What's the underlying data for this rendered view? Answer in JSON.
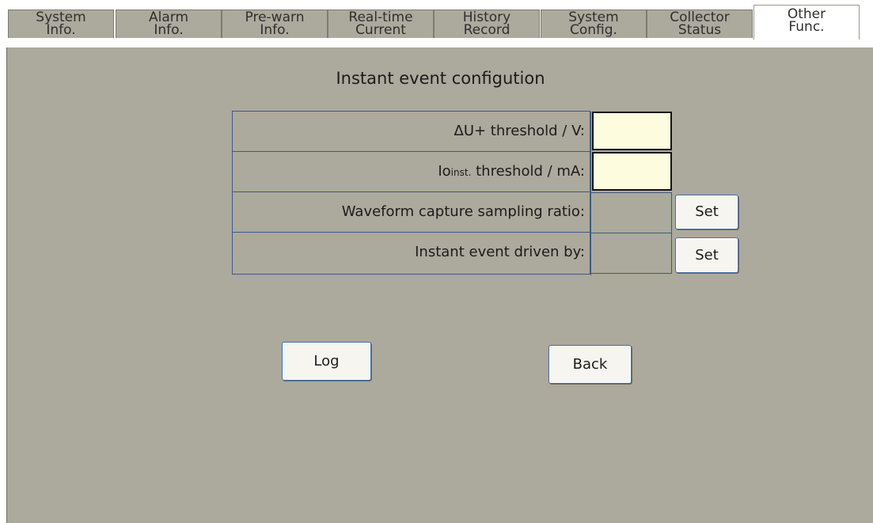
{
  "tabs": [
    {
      "line1": "System",
      "line2": "Info."
    },
    {
      "line1": "Alarm",
      "line2": "Info."
    },
    {
      "line1": "Pre-warn",
      "line2": "Info."
    },
    {
      "line1": "Real-time",
      "line2": "Current"
    },
    {
      "line1": "History",
      "line2": "Record"
    },
    {
      "line1": "System",
      "line2": "Config."
    },
    {
      "line1": "Collector",
      "line2": "Status"
    },
    {
      "line1": "Other",
      "line2": "Func."
    }
  ],
  "active_tab": "Other Func.",
  "page": {
    "title": "Instant event configution"
  },
  "rows": [
    {
      "label": "ΔU+ threshold / V:",
      "value": ""
    },
    {
      "label_main": "Io",
      "label_sub": "inst.",
      "label_rest": " threshold / mA:",
      "value": ""
    },
    {
      "label": "Waveform capture sampling ratio:",
      "value": ""
    },
    {
      "label": "Instant event driven by:",
      "value": ""
    }
  ],
  "buttons": {
    "set_label": "Set",
    "log_label": "Log",
    "back_label": "Back"
  },
  "colors": {
    "panel_bg": "#aca99d",
    "input_bg": "#fefcdf",
    "grid_border": "#3c5b84"
  }
}
